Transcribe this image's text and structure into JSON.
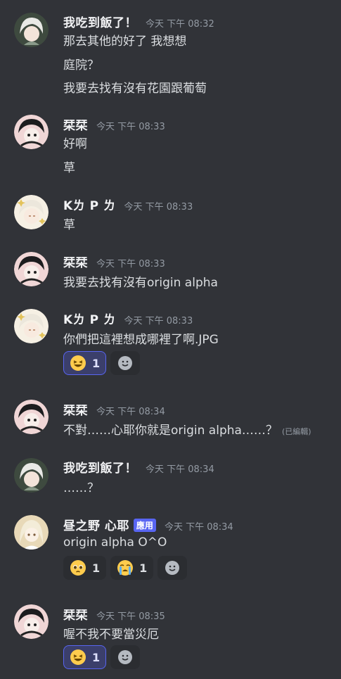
{
  "messages": [
    {
      "username": "我吃到飯了！",
      "timestamp": "今天 下午 08:32",
      "lines": [
        "那去其他的好了 我想想",
        "庭院？",
        "我要去找有沒有花園跟葡萄"
      ]
    },
    {
      "username": "栞栞",
      "timestamp": "今天 下午 08:33",
      "lines": [
        "好啊",
        "草"
      ]
    },
    {
      "username": "Kㄌ P ㄌ",
      "timestamp": "今天 下午 08:33",
      "lines": [
        "草"
      ]
    },
    {
      "username": "栞栞",
      "timestamp": "今天 下午 08:33",
      "lines": [
        "我要去找有沒有origin alpha"
      ]
    },
    {
      "username": "Kㄌ P ㄌ",
      "timestamp": "今天 下午 08:33",
      "lines": [
        "你們把這裡想成哪裡了啊.JPG"
      ],
      "reactions": [
        {
          "emoji": "laughing-emoji",
          "count": "1",
          "active": true
        }
      ]
    },
    {
      "username": "栞栞",
      "timestamp": "今天 下午 08:34",
      "lines": [
        "不對……心耶你就是origin alpha……？"
      ],
      "edited": "(已編輯)"
    },
    {
      "username": "我吃到飯了！",
      "timestamp": "今天 下午 08:34",
      "lines": [
        "……？"
      ]
    },
    {
      "username": "昼之野 心耶",
      "tag": "應用",
      "timestamp": "今天 下午 08:34",
      "lines": [
        "origin alpha O^O"
      ],
      "reactions": [
        {
          "emoji": "pleading-face-emoji",
          "count": "1",
          "active": false
        },
        {
          "emoji": "crying-face-emoji",
          "count": "1",
          "active": false
        }
      ]
    },
    {
      "username": "栞栞",
      "timestamp": "今天 下午 08:35",
      "lines": [
        "喔不我不要當災厄"
      ],
      "reactions": [
        {
          "emoji": "laughing-emoji",
          "count": "1",
          "active": true
        }
      ]
    }
  ],
  "colors": {
    "background": "#313338",
    "username": "#f2f3f5",
    "timestamp": "#949ba4",
    "app_tag": "#5865f2",
    "reaction_active_border": "#5865f2"
  }
}
